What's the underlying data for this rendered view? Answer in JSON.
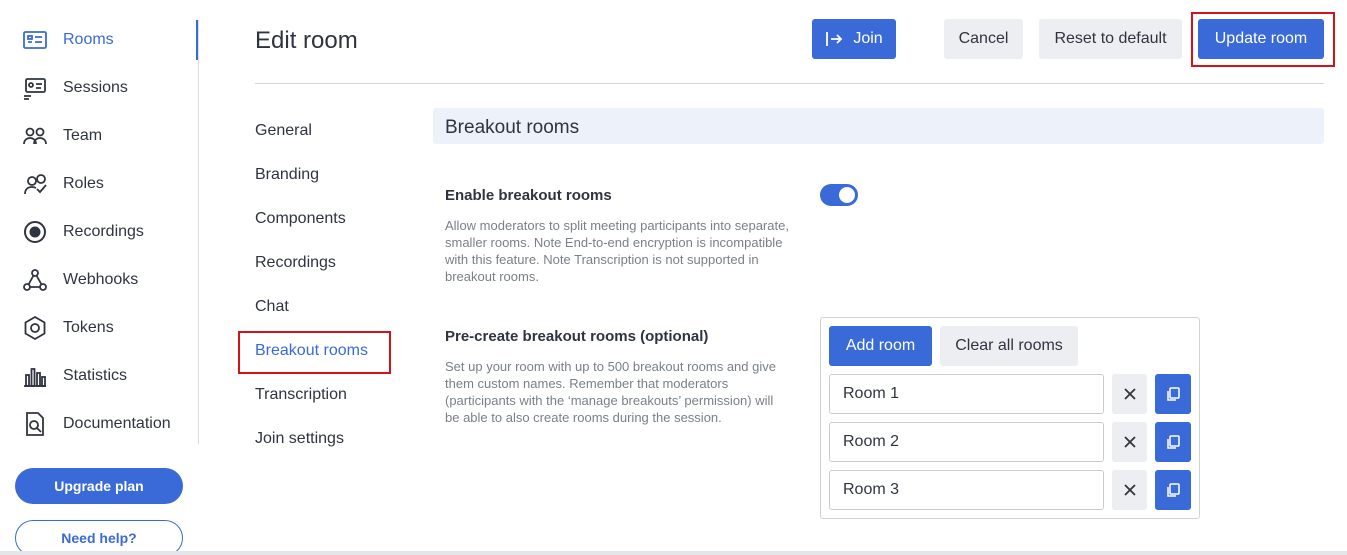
{
  "sidebar": {
    "items": [
      {
        "label": "Rooms",
        "icon": "rooms-icon"
      },
      {
        "label": "Sessions",
        "icon": "sessions-icon"
      },
      {
        "label": "Team",
        "icon": "team-icon"
      },
      {
        "label": "Roles",
        "icon": "roles-icon"
      },
      {
        "label": "Recordings",
        "icon": "recordings-icon"
      },
      {
        "label": "Webhooks",
        "icon": "webhooks-icon"
      },
      {
        "label": "Tokens",
        "icon": "tokens-icon"
      },
      {
        "label": "Statistics",
        "icon": "statistics-icon"
      },
      {
        "label": "Documentation",
        "icon": "documentation-icon"
      }
    ],
    "active": "Rooms",
    "upgrade_label": "Upgrade plan",
    "help_label": "Need help?"
  },
  "header": {
    "title": "Edit room",
    "join_label": "Join",
    "cancel_label": "Cancel",
    "reset_label": "Reset to default",
    "update_label": "Update room"
  },
  "settings_nav": {
    "items": [
      "General",
      "Branding",
      "Components",
      "Recordings",
      "Chat",
      "Breakout rooms",
      "Transcription",
      "Join settings"
    ],
    "active": "Breakout rooms"
  },
  "section": {
    "title": "Breakout rooms",
    "enable": {
      "label": "Enable breakout rooms",
      "description": "Allow moderators to split meeting participants into separate, smaller rooms. Note End-to-end encryption is incompatible with this feature. Note Transcription is not supported in breakout rooms.",
      "enabled": true
    },
    "precreate": {
      "label": "Pre-create breakout rooms (optional)",
      "description": "Set up your room with up to 500 breakout rooms and give them custom names. Remember that moderators (participants with the ‘manage breakouts’ permission) will be able to also create rooms during the session.",
      "add_label": "Add room",
      "clear_label": "Clear all rooms",
      "rooms": [
        "Room 1",
        "Room 2",
        "Room 3"
      ]
    }
  },
  "colors": {
    "accent": "#3a6ad8",
    "highlight": "#d3121b"
  }
}
